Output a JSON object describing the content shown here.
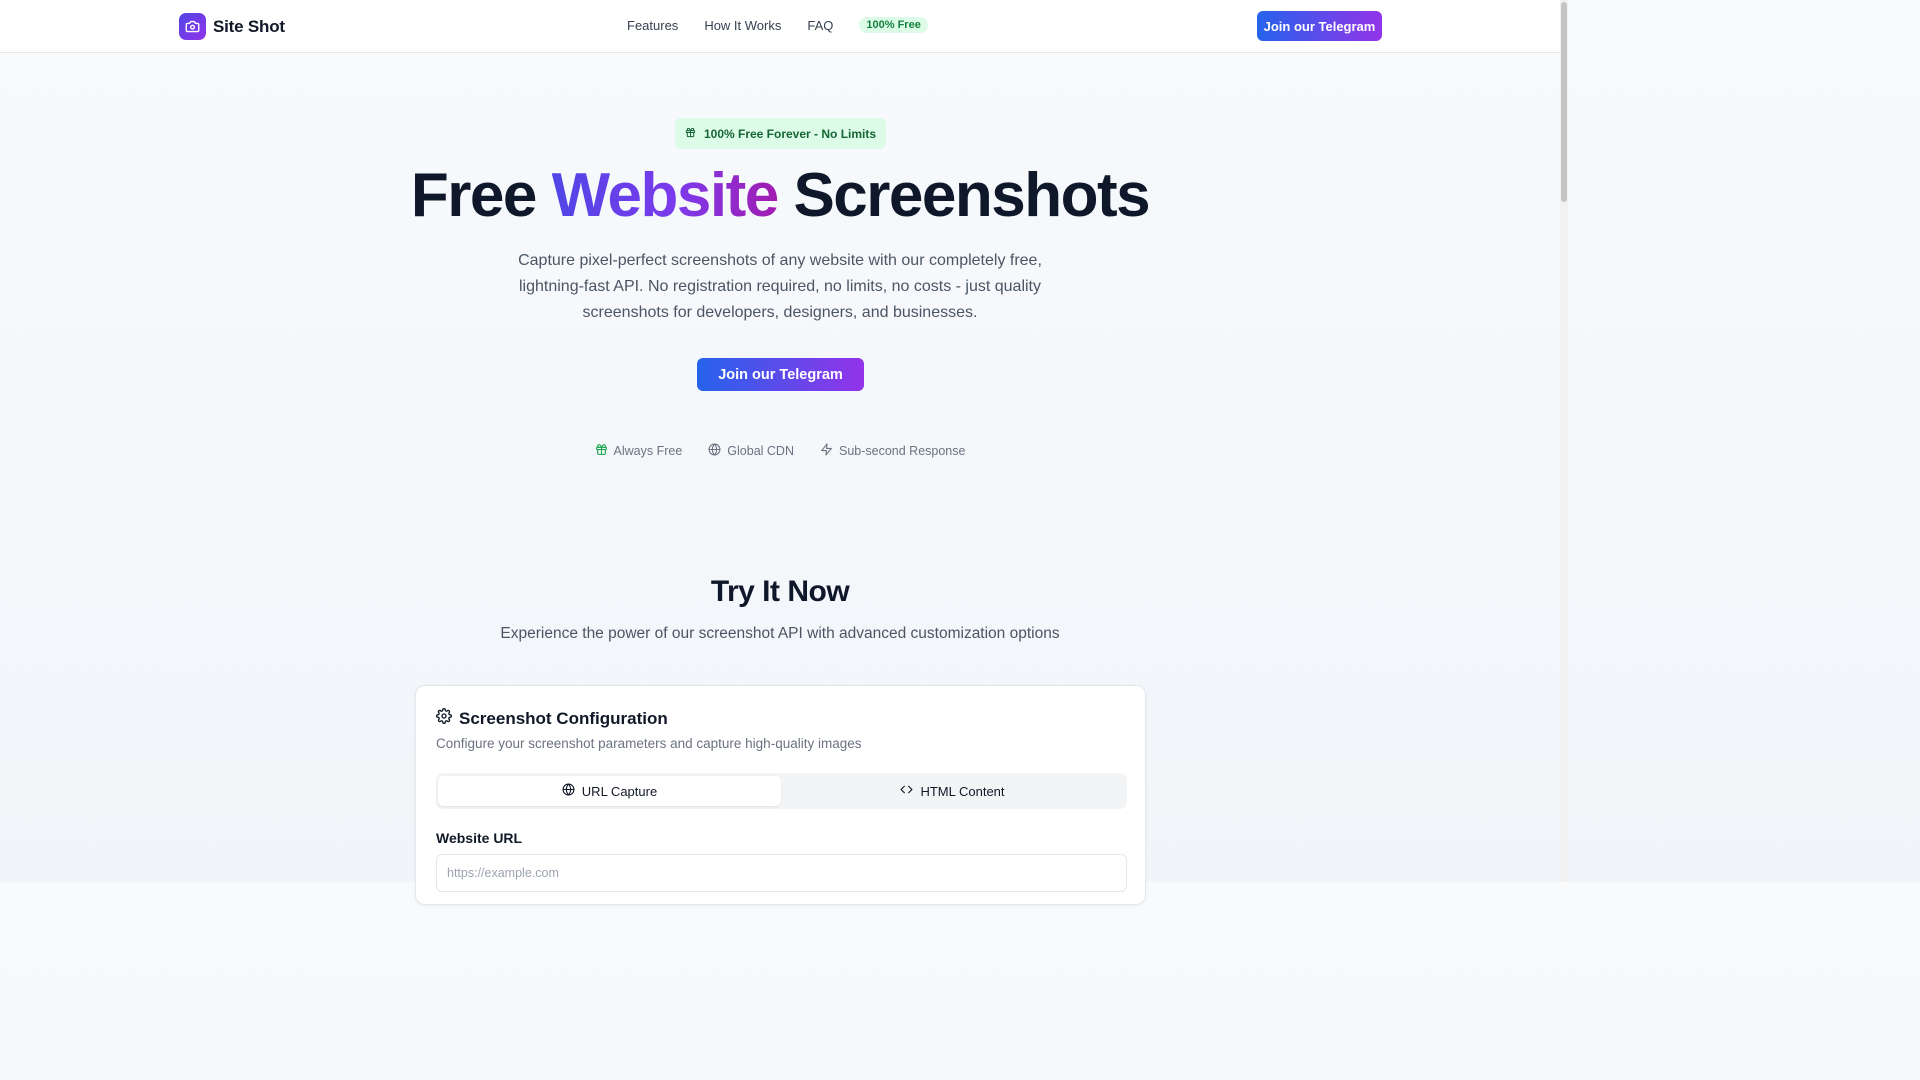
{
  "header": {
    "brand": "Site Shot",
    "nav": [
      "Features",
      "How It Works",
      "FAQ"
    ],
    "badge": "100% Free",
    "cta": "Join our Telegram"
  },
  "hero": {
    "badge": "100% Free Forever - No Limits",
    "title_part1": "Free",
    "title_highlight": "Website",
    "title_part2": "Screenshots",
    "subtitle": "Capture pixel-perfect screenshots of any website with our completely free, lightning-fast API. No registration required, no limits, no costs - just quality screenshots for developers, designers, and businesses.",
    "cta": "Join our Telegram",
    "features": [
      {
        "icon": "gift-icon",
        "label": "Always Free"
      },
      {
        "icon": "globe-icon",
        "label": "Global CDN"
      },
      {
        "icon": "lightning-icon",
        "label": "Sub-second Response"
      }
    ]
  },
  "try_section": {
    "title": "Try It Now",
    "subtitle": "Experience the power of our screenshot API with advanced customization options",
    "card": {
      "title": "Screenshot Configuration",
      "description": "Configure your screenshot parameters and capture high-quality images",
      "tabs": [
        {
          "icon": "globe-icon",
          "label": "URL Capture",
          "active": true
        },
        {
          "icon": "code-icon",
          "label": "HTML Content",
          "active": false
        }
      ],
      "url_label": "Website URL",
      "url_placeholder": "https://example.com",
      "url_value": ""
    }
  },
  "colors": {
    "accent_start": "#2563eb",
    "accent_end": "#9333ea",
    "free_badge_bg": "#dcfce7",
    "free_badge_text": "#15803d"
  }
}
